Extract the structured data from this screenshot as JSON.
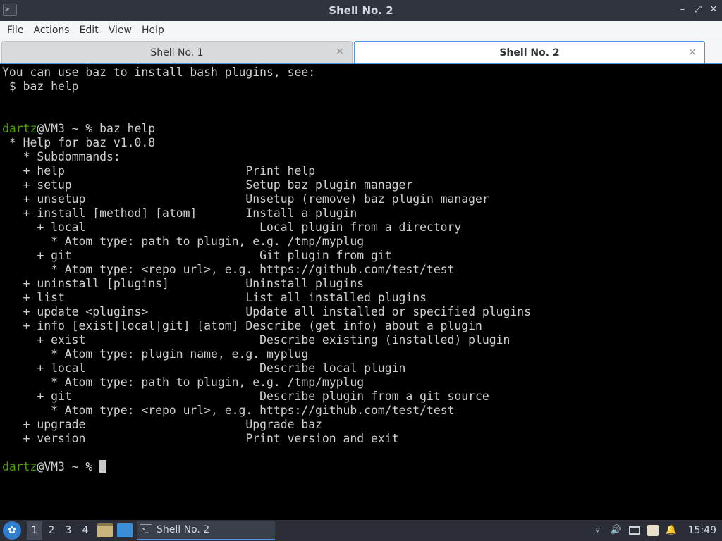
{
  "window": {
    "title": "Shell No. 2",
    "icon": "terminal-icon",
    "controls": {
      "minimize": "–",
      "maximize": "⤢",
      "close": "✕"
    }
  },
  "menu": {
    "items": [
      "File",
      "Actions",
      "Edit",
      "View",
      "Help"
    ]
  },
  "tabs": [
    {
      "label": "Shell No. 1",
      "active": false,
      "close": "×"
    },
    {
      "label": "Shell No. 2",
      "active": true,
      "close": "×"
    }
  ],
  "terminal": {
    "prompt_user": "dartz",
    "prompt_rest": "@VM3 ~ % ",
    "lines": [
      "You can use baz to install bash plugins, see:",
      " $ baz help",
      "",
      "",
      "@@PROMPT@@baz help",
      " * Help for baz v1.0.8",
      "   * Subdommands:",
      "   + help                          Print help",
      "   + setup                         Setup baz plugin manager",
      "   + unsetup                       Unsetup (remove) baz plugin manager",
      "   + install [method] [atom]       Install a plugin",
      "     + local                         Local plugin from a directory",
      "       * Atom type: path to plugin, e.g. /tmp/myplug",
      "     + git                           Git plugin from git",
      "       * Atom type: <repo url>, e.g. https://github.com/test/test",
      "   + uninstall [plugins]           Uninstall plugins",
      "   + list                          List all installed plugins",
      "   + update <plugins>              Update all installed or specified plugins",
      "   + info [exist|local|git] [atom] Describe (get info) about a plugin",
      "     + exist                         Describe existing (installed) plugin",
      "       * Atom type: plugin name, e.g. myplug",
      "     + local                         Describe local plugin",
      "       * Atom type: path to plugin, e.g. /tmp/myplug",
      "     + git                           Describe plugin from a git source",
      "       * Atom type: <repo url>, e.g. https://github.com/test/test",
      "   + upgrade                       Upgrade baz",
      "   + version                       Print version and exit",
      "",
      "@@PROMPT@@@@CURSOR@@"
    ]
  },
  "taskbar": {
    "workspaces": [
      "1",
      "2",
      "3",
      "4"
    ],
    "active_workspace": "1",
    "task_label": "Shell No. 2",
    "clock": "15:49",
    "colors": {
      "accent": "#5294e2",
      "prompt": "#4e9a06"
    }
  }
}
